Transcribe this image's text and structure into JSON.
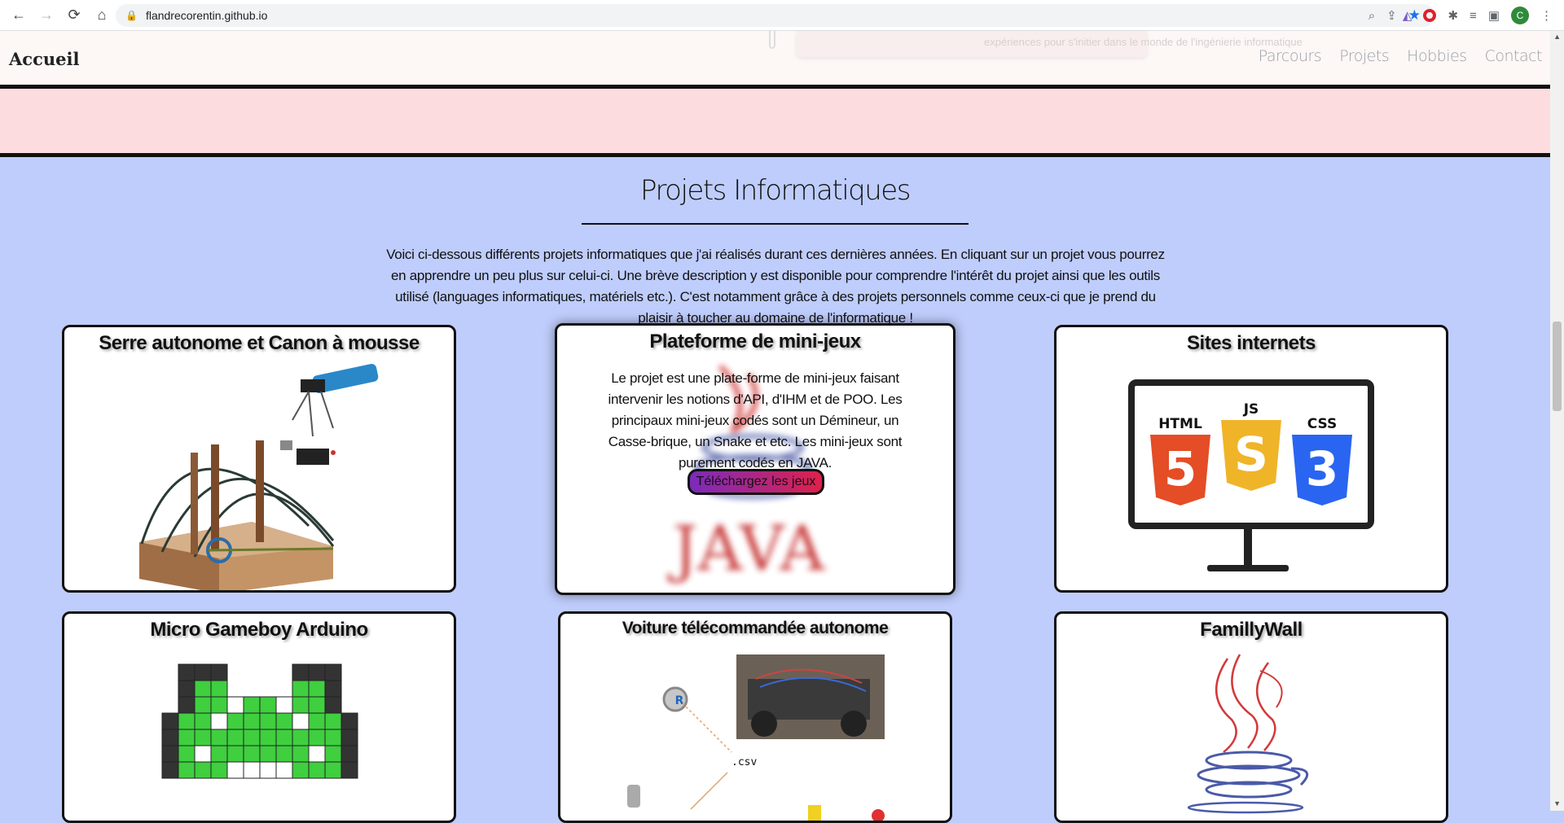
{
  "browser": {
    "url": "flandrecorentin.github.io",
    "avatar_letter": "C"
  },
  "header": {
    "brand": "Accueil",
    "ghost_text": "expériences pour s'initier dans le monde de l'ingénierie informatique",
    "nav": [
      "Parcours",
      "Projets",
      "Hobbies",
      "Contact"
    ]
  },
  "section": {
    "title": "Projets Informatiques",
    "intro": "Voici ci-dessous différents projets informatiques que j'ai réalisés durant ces dernières années. En cliquant sur un projet vous pourrez en apprendre un peu plus sur celui-ci. Une brève description y est disponible pour comprendre l'intérêt du projet ainsi que les outils utilisé (languages informatiques, matériels etc.). C'est notamment grâce à des projets personnels comme ceux-ci que je prend du plaisir à toucher au domaine de l'informatique !"
  },
  "cards": {
    "serre": {
      "title": "Serre autonome et Canon à mousse"
    },
    "minijeux": {
      "title": "Plateforme de mini-jeux",
      "description": "Le projet est une plate-forme de mini-jeux faisant intervenir les notions d'API, d'IHM et de POO. Les principaux mini-jeux codés sont un Démineur, un Casse-brique, un Snake et etc. Les mini-jeux sont purement codés en JAVA.",
      "button": "Téléchargez les jeux",
      "bg_logo_text": "JAVA"
    },
    "sites": {
      "title": "Sites internets",
      "html_label": "HTML",
      "js_label": "JS",
      "css_label": "CSS",
      "html_num": "5",
      "js_num": "S",
      "css_num": "3"
    },
    "gameboy": {
      "title": "Micro Gameboy Arduino"
    },
    "voiture": {
      "title": "Voiture télécommandée autonome",
      "csv_label": ".csv",
      "r_label": "R"
    },
    "familywall": {
      "title": "FamillyWall"
    }
  },
  "colors": {
    "page_bg": "#bfcdfc",
    "pink_band": "#fcdcdf",
    "header_bg": "#fdf7f6",
    "html_orange": "#e44d26",
    "js_yellow": "#f0b429",
    "css_blue": "#2965f1",
    "gameboy_green": "#3fcf3f"
  }
}
